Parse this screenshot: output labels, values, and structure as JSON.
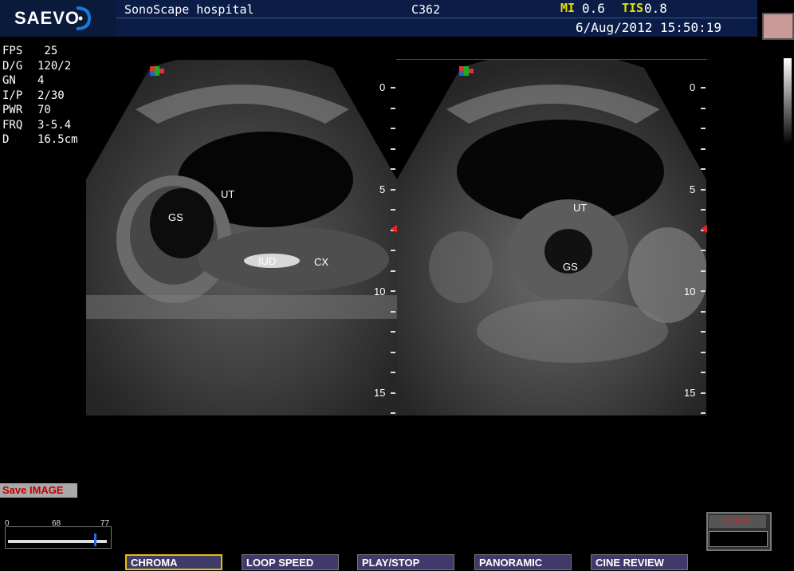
{
  "header": {
    "logo": "SAEVO",
    "hospital": "SonoScape hospital",
    "probe": "C362",
    "mi_label": "MI",
    "mi_value": "0.6",
    "tis_label": "TIS",
    "tis_value": "0.8",
    "datetime": "6/Aug/2012 15:50:19"
  },
  "params": [
    {
      "key": "FPS",
      "value": " 25"
    },
    {
      "key": "D/G",
      "value": "120/2"
    },
    {
      "key": "GN",
      "value": "4"
    },
    {
      "key": "I/P",
      "value": "2/30"
    },
    {
      "key": "PWR",
      "value": "70"
    },
    {
      "key": "FRQ",
      "value": "3-5.4"
    },
    {
      "key": "D",
      "value": "16.5cm"
    }
  ],
  "left_image": {
    "labels": [
      "UT",
      "GS",
      "IUD",
      "CX"
    ]
  },
  "right_image": {
    "labels": [
      "UT",
      "GS"
    ]
  },
  "depth_scale": [
    "0",
    "5",
    "10",
    "15"
  ],
  "save_label": "Save IMAGE",
  "slider": {
    "min": "0",
    "mid": "68",
    "max": "77",
    "value": 77
  },
  "cine": {
    "label": "CINE"
  },
  "buttons": [
    {
      "label": "CHROMA",
      "active": true
    },
    {
      "label": "LOOP SPEED",
      "active": false
    },
    {
      "label": "PLAY/STOP",
      "active": false
    },
    {
      "label": "PANORAMIC",
      "active": false
    },
    {
      "label": "CINE REVIEW",
      "active": false
    }
  ],
  "colors": {
    "header_bg": "#0b1d47",
    "mi_label": "#e8e000",
    "save_text": "#c00000",
    "button_bg": "#3f3a6a",
    "active_border": "#e3c100"
  }
}
